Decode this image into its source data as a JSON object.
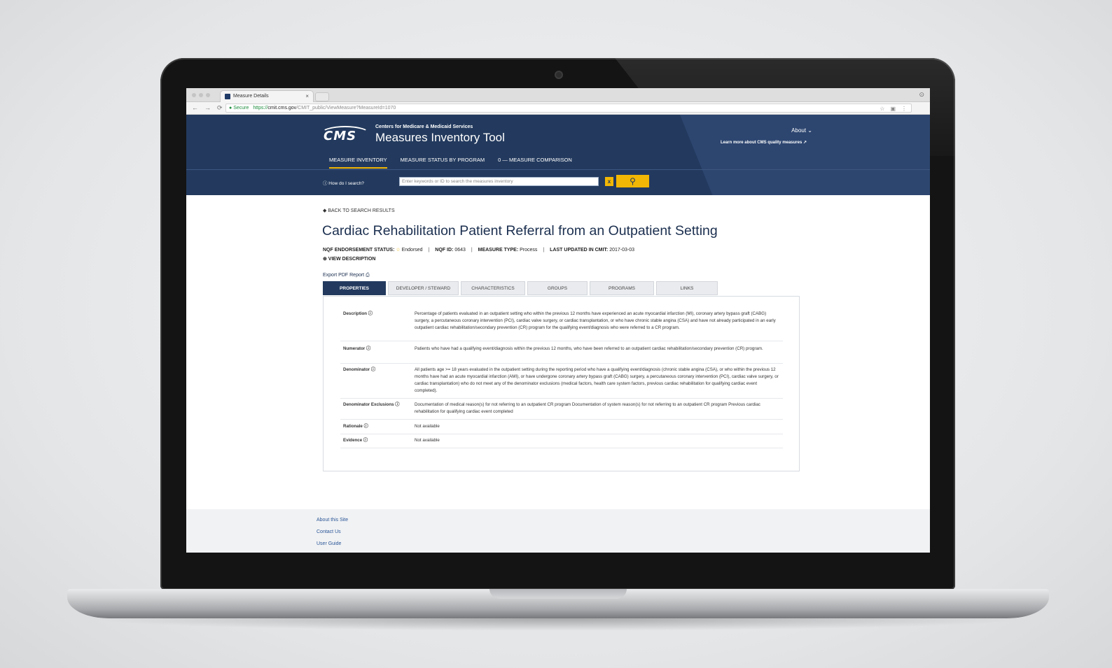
{
  "browser": {
    "tab_title": "Measure Details",
    "tab_close": "×",
    "secure_label": "Secure",
    "url_scheme": "https://",
    "url_host": "cmit.cms.gov",
    "url_path": "/CMIT_public/ViewMeasure?MeasureId=1070",
    "lock_icon": "lock-icon",
    "back_icon": "←",
    "forward_icon": "→",
    "reload_icon": "⟳"
  },
  "header": {
    "logo_text": "CMS",
    "org_name": "Centers for Medicare & Medicaid Services",
    "app_title": "Measures Inventory Tool",
    "about_label": "About ⌄",
    "learn_more_label": "Learn more about CMS quality measures ↗",
    "nav": [
      {
        "label": "MEASURE INVENTORY"
      },
      {
        "label": "MEASURE STATUS BY PROGRAM"
      },
      {
        "label": "0 — MEASURE COMPARISON"
      }
    ],
    "how_search_label": "ⓘ How do I search?",
    "search_placeholder": "Enter keywords or ID to search the measures inventory",
    "clear_label": "x",
    "search_icon": "search-icon",
    "accent_color": "#f2b705",
    "brand_color": "#233a5e"
  },
  "content": {
    "back_link": "◆ BACK TO SEARCH RESULTS",
    "title": "Cardiac Rehabilitation Patient Referral from an Outpatient Setting",
    "meta": {
      "endorsement_label": "NQF ENDORSEMENT STATUS:",
      "endorsement_value": "Endorsed",
      "nqf_label": "NQF ID:",
      "nqf_value": "0643",
      "type_label": "MEASURE TYPE:",
      "type_value": "Process",
      "updated_label": "LAST UPDATED IN CMIT:",
      "updated_value": "2017-03-03"
    },
    "view_description": "⊕ VIEW DESCRIPTION",
    "export_label": "Export PDF Report ⎙",
    "tabs": [
      {
        "label": "PROPERTIES"
      },
      {
        "label": "DEVELOPER / STEWARD"
      },
      {
        "label": "CHARACTERISTICS"
      },
      {
        "label": "GROUPS"
      },
      {
        "label": "PROGRAMS"
      },
      {
        "label": "LINKS"
      }
    ],
    "properties": [
      {
        "label": "Description ⓘ",
        "value": "Percentage of patients evaluated in an outpatient setting who within the previous 12 months have experienced an acute myocardial infarction (MI), coronary artery bypass graft (CABG) surgery, a percutaneous coronary intervention (PCI), cardiac valve surgery, or cardiac transplantation, or who have chronic stable angina (CSA) and have not already participated in an early outpatient cardiac rehabilitation/secondary prevention (CR) program for the qualifying event/diagnosis who were referred to a CR program."
      },
      {
        "label": "Numerator ⓘ",
        "value": "Patients who have had a qualifying event/diagnosis within the previous 12 months, who have been referred to an outpatient cardiac rehabilitation/secondary prevention (CR) program."
      },
      {
        "label": "Denominator ⓘ",
        "value": "All patients age >= 18 years evaluated in the outpatient setting during the reporting period who have a qualifying event/diagnosis (chronic stable angina (CSA), or who within the previous 12 months have had an acute myocardial infarction (AMI), or have undergone coronary artery bypass graft (CABG) surgery, a percutaneous coronary intervention (PCI), cardiac valve surgery, or cardiac transplantation) who do not meet any of the denominator exclusions (medical factors, health care system factors, previous cardiac rehabilitation for qualifying cardiac event completed)."
      },
      {
        "label": "Denominator Exclusions ⓘ",
        "value": "Documentation of medical reason(s) for not referring to an outpatient CR program Documentation of system reason(s) for not referring to an outpatient CR program Previous cardiac rehabilitation for qualifying cardiac event completed"
      },
      {
        "label": "Rationale ⓘ",
        "value": "Not available"
      },
      {
        "label": "Evidence ⓘ",
        "value": "Not available"
      }
    ]
  },
  "footer": {
    "links": [
      "About this Site",
      "Contact Us",
      "User Guide"
    ]
  }
}
